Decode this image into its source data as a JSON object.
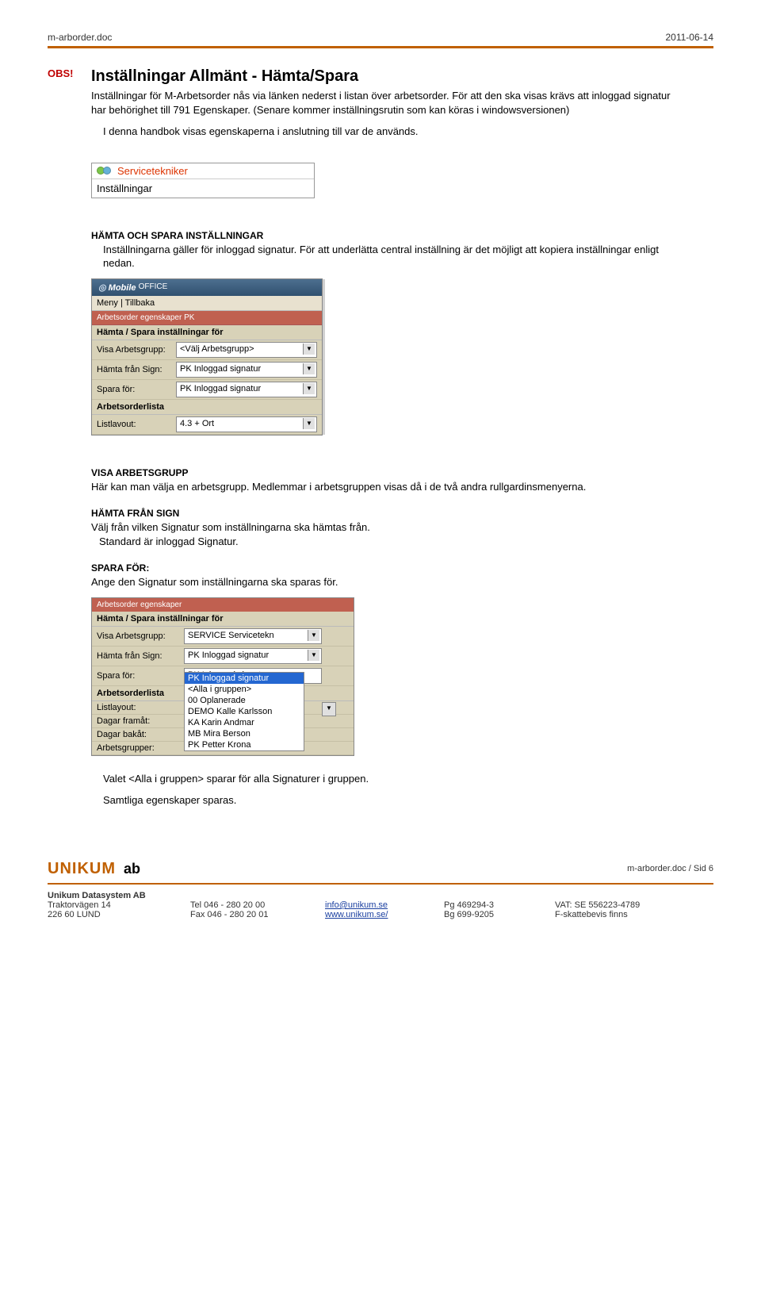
{
  "header": {
    "doc": "m-arborder.doc",
    "date": "2011-06-14"
  },
  "obs": "OBS!",
  "title": "Inställningar Allmänt - Hämta/Spara",
  "intro": "Inställningar för M-Arbetsorder nås via länken nederst i listan över arbetsorder. För att den ska visas krävs att inloggad signatur har behörighet till 791 Egenskaper. (Senare kommer inställningsrutin som kan köras i windowsversionen)",
  "sub1": "I denna handbok visas egenskaperna i anslutning till var de används.",
  "svc": {
    "role": "Servicetekniker",
    "link": "Inställningar"
  },
  "hamta_spara": {
    "heading": "HÄMTA OCH SPARA INSTÄLLNINGAR",
    "text": "Inställningarna gäller för inloggad signatur. För att underlätta central inställning är det möjligt att kopiera inställningar enligt nedan."
  },
  "mo": {
    "brand": "Mobile",
    "brand2": "OFFICE",
    "nav": "Meny | Tillbaka",
    "section": "Arbetsorder egenskaper PK",
    "panel": "Hämta / Spara inställningar för",
    "rows": [
      {
        "label": "Visa Arbetsgrupp:",
        "value": "<Välj Arbetsgrupp>"
      },
      {
        "label": "Hämta från Sign:",
        "value": "PK Inloggad signatur"
      },
      {
        "label": "Spara för:",
        "value": "PK Inloggad signatur"
      }
    ],
    "listsection": "Arbetsorderlista",
    "listrow": {
      "label": "Listlavout:",
      "value": "4.3 + Ort"
    }
  },
  "visa": {
    "heading": "VISA ARBETSGRUPP",
    "text": "Här kan man välja en arbetsgrupp. Medlemmar i arbetsgruppen visas då i de två andra rullgardinsmenyerna."
  },
  "hamtasign": {
    "heading": "HÄMTA FRÅN SIGN",
    "l1": "Välj från vilken Signatur som inställningarna ska hämtas från.",
    "l2": "Standard är inloggad Signatur."
  },
  "sparafor": {
    "heading": "SPARA FÖR:",
    "text": "Ange den Signatur som inställningarna ska sparas för."
  },
  "eg": {
    "section": "Arbetsorder egenskaper",
    "panel": "Hämta / Spara inställningar för",
    "rows": [
      {
        "label": "Visa Arbetsgrupp:",
        "value": "SERVICE Servicetekn"
      },
      {
        "label": "Hämta från Sign:",
        "value": "PK Inloggad signatur"
      },
      {
        "label": "Spara för:",
        "value": "PK Inloggad signatur"
      }
    ],
    "options": [
      "PK Inloggad signatur",
      "<Alla i gruppen>",
      "00 Oplanerade",
      "DEMO Kalle Karlsson",
      "KA Karin Andmar",
      "MB Mira Berson",
      "PK Petter Krona"
    ],
    "selected_option": 0,
    "listsection": "Arbetsorderlista",
    "extra": [
      {
        "label": "Listlayout:"
      },
      {
        "label": "Dagar framåt:"
      },
      {
        "label": "Dagar bakåt:"
      },
      {
        "label": "Arbetsgrupper:"
      }
    ]
  },
  "final1": "Valet <Alla i gruppen> sparar för alla Signaturer i gruppen.",
  "final2": "Samtliga egenskaper sparas.",
  "footer": {
    "logo1": "UNIKUM",
    "logo2": "ab",
    "pageref": "m-arborder.doc / Sid 6",
    "company": "Unikum Datasystem AB",
    "addr1": "Traktorvägen 14",
    "addr2": "226 60  LUND",
    "tel": "Tel   046 - 280 20 00",
    "fax": "Fax  046 - 280 20 01",
    "email": "info@unikum.se",
    "web": "www.unikum.se/",
    "pg": "Pg  469294-3",
    "bg": "Bg  699-9205",
    "vat": "VAT: SE 556223-4789",
    "fskatt": "F-skattebevis finns"
  }
}
